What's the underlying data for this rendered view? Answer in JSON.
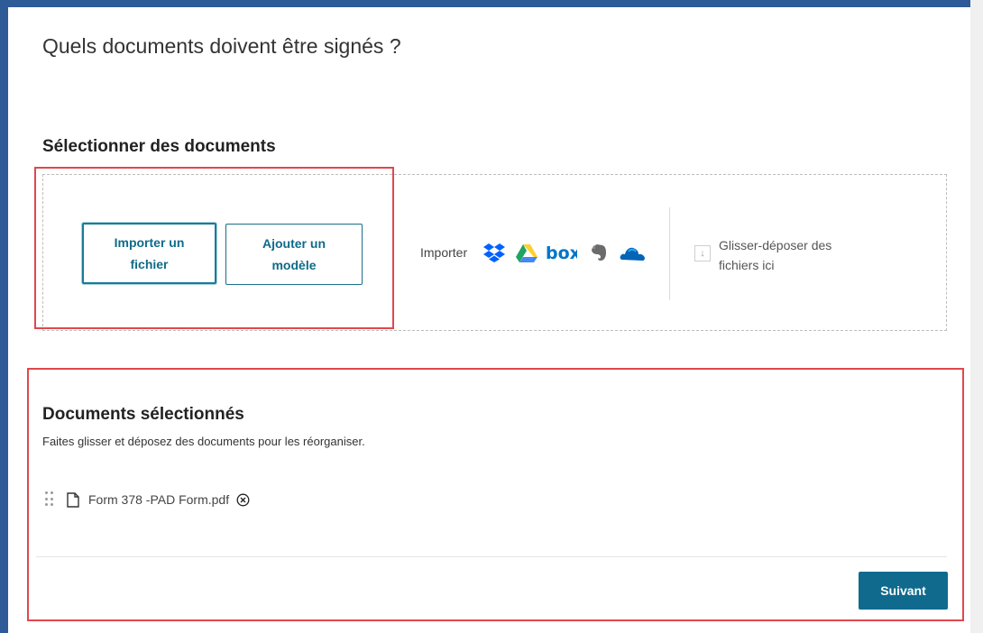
{
  "page": {
    "title": "Quels documents doivent être signés ?"
  },
  "select_section": {
    "title": "Sélectionner des documents",
    "import_file_label": "Importer un fichier",
    "add_template_label": "Ajouter un modèle",
    "import_label": "Importer",
    "cloud_sources": [
      {
        "name": "dropbox-icon",
        "color": "#0061fe"
      },
      {
        "name": "google-drive-icon",
        "color": "#1fa463"
      },
      {
        "name": "box-icon",
        "text": "box",
        "color": "#0075c9"
      },
      {
        "name": "evernote-icon",
        "color": "#6b6b6b"
      },
      {
        "name": "onedrive-icon",
        "color": "#0364b8"
      }
    ],
    "drop_text": "Glisser-déposer des fichiers ici"
  },
  "selected_section": {
    "title": "Documents sélectionnés",
    "subtitle": "Faites glisser et déposez des documents pour les réorganiser.",
    "documents": [
      {
        "name": "Form 378 -PAD Form.pdf"
      }
    ]
  },
  "footer": {
    "next_label": "Suivant"
  },
  "colors": {
    "accent": "#0f6a8d",
    "highlight": "#e0484c",
    "frame": "#2e5a98"
  }
}
